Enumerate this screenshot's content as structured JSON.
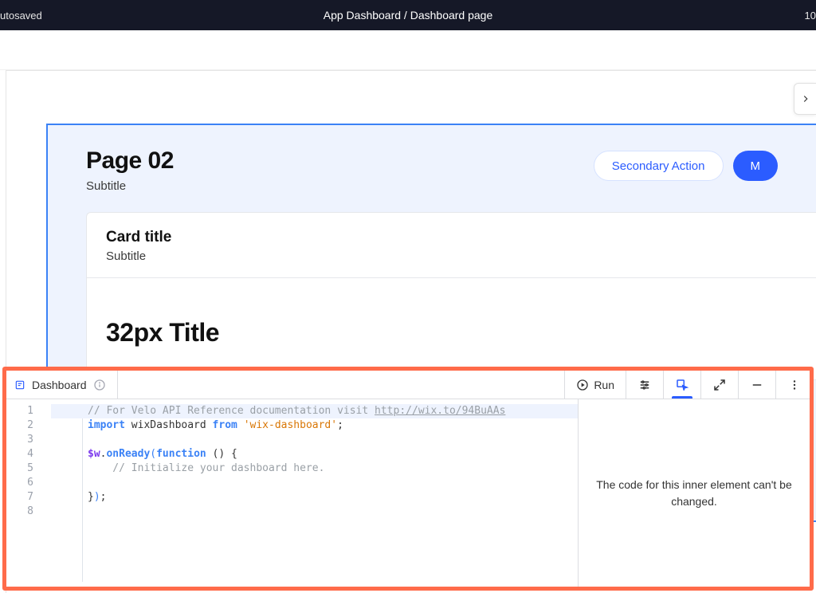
{
  "topbar": {
    "left": "utosaved",
    "breadcrumb_a": "App Dashboard",
    "breadcrumb_sep": " / ",
    "breadcrumb_b": "Dashboard page",
    "right": "10"
  },
  "page": {
    "title": "Page 02",
    "subtitle": "Subtitle",
    "secondary_action": "Secondary Action",
    "primary_action_partial": "M"
  },
  "card": {
    "title": "Card title",
    "subtitle": "Subtitle",
    "big_title": "32px Title"
  },
  "codepanel": {
    "tab_label": "Dashboard",
    "run_label": "Run",
    "side_message": "The code for this inner element can't be changed.",
    "gutter": [
      "1",
      "2",
      "3",
      "4",
      "5",
      "6",
      "7",
      "8"
    ],
    "code": {
      "l1_comment_pre": "// For Velo API Reference documentation visit ",
      "l1_link": "http://wix.to/94BuAAs",
      "l2_import": "import",
      "l2_name": " wixDashboard ",
      "l2_from": "from",
      "l2_sp": " ",
      "l2_str": "'wix-dashboard'",
      "l2_semi": ";",
      "l4_dol": "$w",
      "l4_dot": ".",
      "l4_onready": "onReady",
      "l4_open": "(",
      "l4_func": "function",
      "l4_rest": " () {",
      "l5_comment": "    // Initialize your dashboard here.",
      "l7_close": "}",
      "l7_paren": ")",
      "l7_semi": ";"
    }
  }
}
